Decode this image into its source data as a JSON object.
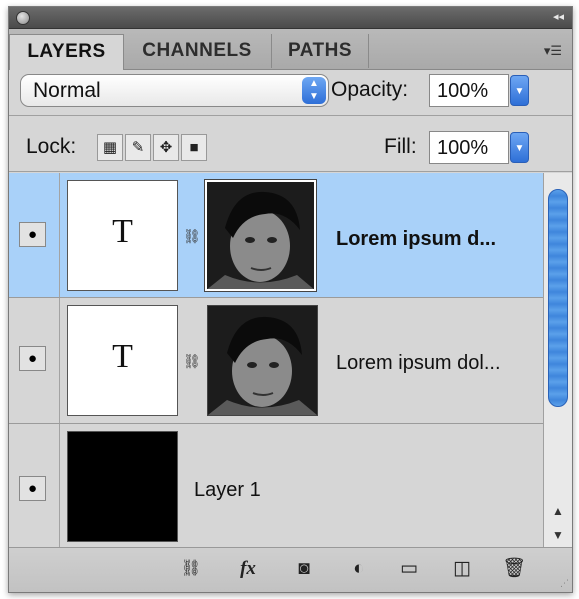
{
  "tabs": [
    {
      "label": "LAYERS",
      "active": true
    },
    {
      "label": "CHANNELS",
      "active": false
    },
    {
      "label": "PATHS",
      "active": false
    }
  ],
  "blend_mode": {
    "value": "Normal"
  },
  "opacity": {
    "label": "Opacity:",
    "value": "100%"
  },
  "lock": {
    "label": "Lock:"
  },
  "fill": {
    "label": "Fill:",
    "value": "100%"
  },
  "layers": [
    {
      "name": "Lorem ipsum d...",
      "thumb": "T",
      "selected": true,
      "visible": true
    },
    {
      "name": "Lorem ipsum dol...",
      "thumb": "T",
      "selected": false,
      "visible": true
    },
    {
      "name": "Layer 1",
      "selected": false,
      "visible": true
    }
  ],
  "bottom_toolbar": {
    "fx_label": "fx"
  },
  "icons": {
    "panel_menu": "panel-menu-icon",
    "eye": "eye-icon",
    "link": "chain-link-icon",
    "lock_transparent": "lock-transparent-pixels-icon",
    "lock_image": "brush-icon",
    "lock_position": "move-icon",
    "lock_all": "padlock-icon"
  },
  "colors": {
    "selection": "#a9d1f9",
    "accent": "#3f86dc"
  }
}
